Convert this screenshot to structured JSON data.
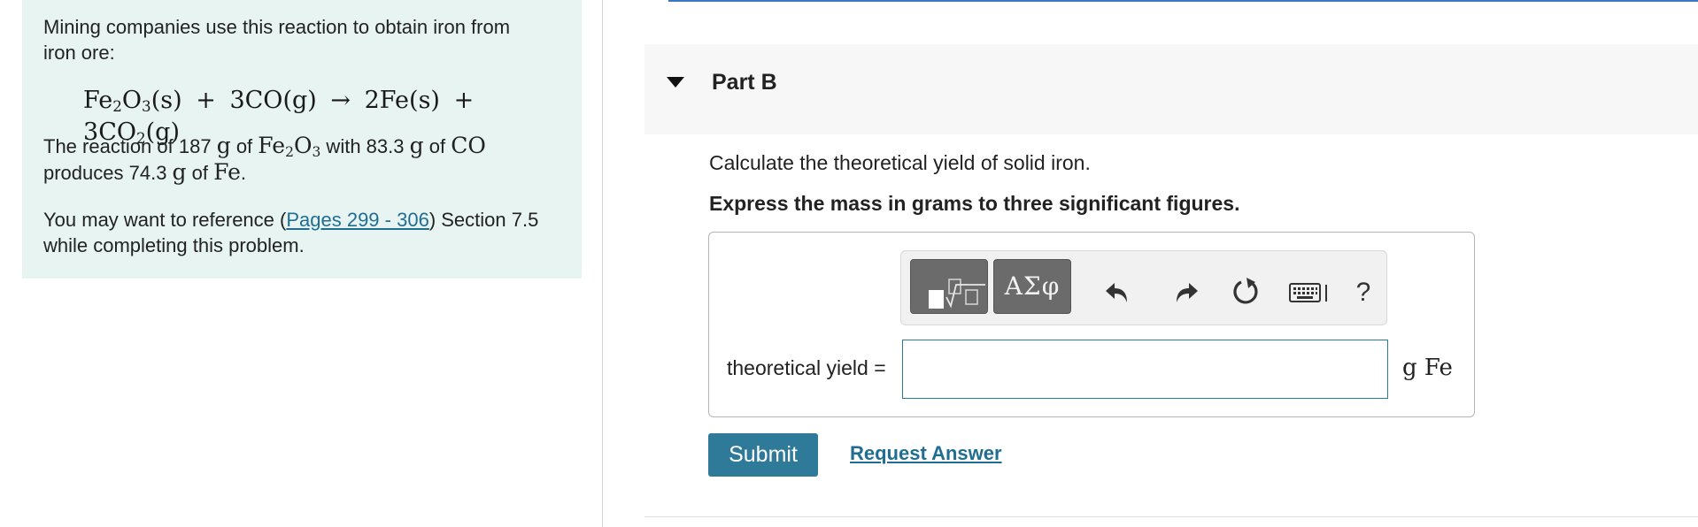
{
  "problem": {
    "intro": "Mining companies use this reaction to obtain iron from iron ore:",
    "equation": {
      "reactant1": {
        "el1": "Fe",
        "sub1": "2",
        "el2": "O",
        "sub2": "3",
        "state": "(s)"
      },
      "reactant2": {
        "coef": "3",
        "formula": "CO",
        "state": "(g)"
      },
      "arrow": "→",
      "product1": {
        "coef": "2",
        "formula": "Fe",
        "state": "(s)"
      },
      "product2": {
        "coef": "3",
        "formula": "CO",
        "sub": "2",
        "state": "(g)"
      },
      "plus": "+"
    },
    "reaction": {
      "t1": "The reaction of 187 ",
      "unit1": "g",
      "t2": " of ",
      "fe2o3_el1": "Fe",
      "fe2o3_sub1": "2",
      "fe2o3_el2": "O",
      "fe2o3_sub2": "3",
      "t3": " with 83.3 ",
      "unit2": "g",
      "t4": " of ",
      "co": "CO",
      "t5": " produces 74.3 ",
      "unit3": "g",
      "t6": " of ",
      "fe": "Fe",
      "t7": "."
    },
    "reference": {
      "before": "You may want to reference (",
      "link": "Pages 299 - 306",
      "after": ") Section 7.5 while completing this problem."
    }
  },
  "part": {
    "title": "Part B",
    "question": "Calculate the theoretical yield of solid iron.",
    "instruction": "Express the mass in grams to three significant figures."
  },
  "toolbar": {
    "symbols_label": "ΑΣφ",
    "help_label": "?"
  },
  "answer": {
    "label": "theoretical yield =",
    "value": "",
    "unit": "g Fe"
  },
  "actions": {
    "submit_label": "Submit",
    "request_label": "Request Answer"
  },
  "colors": {
    "panel_bg": "#e7f4f2",
    "submit_bg": "#2f7a99",
    "link": "#1f6e92",
    "top_rule": "#3a77c4"
  }
}
